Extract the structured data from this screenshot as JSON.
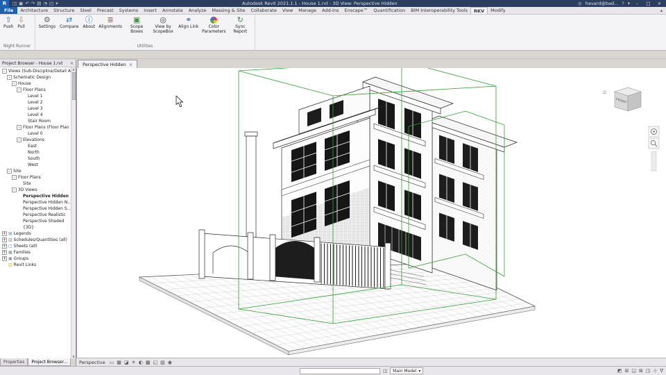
{
  "title_bar": {
    "app_button": "R",
    "title": "Autodesk Revit 2021.1.1 - House 1.rvt - 3D View: Perspective Hidden",
    "qat": [
      {
        "name": "open-icon",
        "glyph": "◫"
      },
      {
        "name": "save-icon",
        "glyph": "▣"
      },
      {
        "name": "undo-icon",
        "glyph": "↶"
      },
      {
        "name": "redo-icon",
        "glyph": "↷"
      },
      {
        "name": "print-icon",
        "glyph": "▤"
      },
      {
        "name": "measure-icon",
        "glyph": "◔"
      },
      {
        "name": "default-3d-view-icon",
        "glyph": "◰"
      },
      {
        "name": "qat-customize-icon",
        "glyph": "▾"
      }
    ],
    "right": {
      "search_glyph": "◎",
      "user": "havard@bad...",
      "help": "?",
      "dropdown": "▾",
      "minimize": "–",
      "maximize": "□",
      "close": "×"
    }
  },
  "ribbon": {
    "tabs": [
      {
        "label": "File",
        "style": "file"
      },
      {
        "label": "Architecture"
      },
      {
        "label": "Structure"
      },
      {
        "label": "Steel"
      },
      {
        "label": "Precast"
      },
      {
        "label": "Systems"
      },
      {
        "label": "Insert"
      },
      {
        "label": "Annotate"
      },
      {
        "label": "Analyze"
      },
      {
        "label": "Massing & Site"
      },
      {
        "label": "Collaborate"
      },
      {
        "label": "View"
      },
      {
        "label": "Manage"
      },
      {
        "label": "Add-Ins"
      },
      {
        "label": "Enscape™"
      },
      {
        "label": "Quantification"
      },
      {
        "label": "BIM Interoperability Tools"
      },
      {
        "label": "RKV",
        "style": "active"
      },
      {
        "label": "Modify"
      }
    ],
    "collapse_glyph": "▴",
    "groups": [
      {
        "label": "Night Runner",
        "buttons": [
          {
            "label": "Push",
            "glyph": "⇧",
            "color": "#2e7cc4"
          },
          {
            "label": "Pull",
            "glyph": "⇩",
            "color": "#c2862a"
          }
        ]
      },
      {
        "label": "Utilities",
        "buttons": [
          {
            "label": "Settings",
            "glyph": "⚙",
            "color": "#666666"
          },
          {
            "label": "Compare",
            "glyph": "⇄",
            "color": "#2e7cc4"
          },
          {
            "label": "About",
            "glyph": "ⓘ",
            "color": "#2e7cc4"
          },
          {
            "label": "Alignments",
            "glyph": "≣",
            "color": "#7a4fa0"
          },
          {
            "label": "Scope Boxes",
            "glyph": "▣",
            "color": "#3f8f3f"
          },
          {
            "label": "View by ScopeBox",
            "glyph": "◎",
            "color": "#444444"
          },
          {
            "label": "Align Link",
            "glyph": "⚭",
            "color": "#2e7cc4"
          },
          {
            "label": "Color Parameters",
            "glyph": "@colorwheel",
            "color": ""
          },
          {
            "label": "Sync Report",
            "glyph": "↻",
            "color": "#3f8f3f"
          }
        ]
      }
    ]
  },
  "project_browser": {
    "header": "Project Browser - House 1.rvt",
    "close_glyph": "×",
    "items": [
      {
        "label": "Views (Sub-Discipline/Detail Area",
        "level": 0,
        "exp": "-"
      },
      {
        "label": "Schematic Design",
        "level": 1,
        "exp": "-"
      },
      {
        "label": "House",
        "level": 2,
        "exp": "-"
      },
      {
        "label": "Floor Plans",
        "level": 3,
        "exp": "-"
      },
      {
        "label": "Level 1",
        "level": 4
      },
      {
        "label": "Level 2",
        "level": 4
      },
      {
        "label": "Level 3",
        "level": 4
      },
      {
        "label": "Level 4",
        "level": 4
      },
      {
        "label": "Stair Room",
        "level": 4
      },
      {
        "label": "Floor Plans (Floor Plan D",
        "level": 3,
        "exp": "-"
      },
      {
        "label": "Level 0",
        "level": 4
      },
      {
        "label": "Elevations",
        "level": 3,
        "exp": "-"
      },
      {
        "label": "East",
        "level": 4
      },
      {
        "label": "North",
        "level": 4
      },
      {
        "label": "South",
        "level": 4
      },
      {
        "label": "West",
        "level": 4
      },
      {
        "label": "Site",
        "level": 1,
        "exp": "-"
      },
      {
        "label": "Floor Plans",
        "level": 2,
        "exp": "-"
      },
      {
        "label": "Site",
        "level": 3
      },
      {
        "label": "3D Views",
        "level": 2,
        "exp": "-"
      },
      {
        "label": "Perspective Hidden",
        "level": 3,
        "bold": true
      },
      {
        "label": "Perspective Hidden N...",
        "level": 3
      },
      {
        "label": "Perspective Hidden S...",
        "level": 3
      },
      {
        "label": "Perspective Realistic",
        "level": 3
      },
      {
        "label": "Perspective Shaded",
        "level": 3
      },
      {
        "label": "{3D}",
        "level": 3
      },
      {
        "label": "Legends",
        "level": 0,
        "exp": "+",
        "icon": "▤",
        "icon_color": "#6a8caf"
      },
      {
        "label": "Schedules/Quantities (all)",
        "level": 0,
        "exp": "+",
        "icon": "▥",
        "icon_color": "#888888"
      },
      {
        "label": "Sheets (all)",
        "level": 0,
        "exp": "+",
        "icon": "▢",
        "icon_color": "#5577aa"
      },
      {
        "label": "Families",
        "level": 0,
        "exp": "+",
        "icon": "▦",
        "icon_color": "#888888"
      },
      {
        "label": "Groups",
        "level": 0,
        "exp": "+",
        "icon": "▣",
        "icon_color": "#888888"
      },
      {
        "label": "Revit Links",
        "level": 0,
        "icon": "◫",
        "icon_color": "#dd8800"
      }
    ],
    "tabs": [
      {
        "label": "Properties",
        "active": false
      },
      {
        "label": "Project Browser...",
        "active": true
      }
    ]
  },
  "viewport": {
    "tab_label": "Perspective Hidden",
    "tab_close": "×",
    "viewcube_label": "FRONT",
    "viewcube_home_glyph": "⌂"
  },
  "view_control_bar": {
    "scale_label": "Perspective",
    "icons": [
      {
        "name": "view-size-icon",
        "glyph": "▭"
      },
      {
        "name": "detail-level-icon",
        "glyph": "▦"
      },
      {
        "name": "visual-style-icon",
        "glyph": "◪"
      },
      {
        "name": "sun-path-icon",
        "glyph": "☀"
      },
      {
        "name": "shadows-icon",
        "glyph": "◐"
      },
      {
        "name": "crop-view-icon",
        "glyph": "▩"
      },
      {
        "name": "show-crop-region-icon",
        "glyph": "◱"
      },
      {
        "name": "temporary-hide-isolate-icon",
        "glyph": "▨"
      },
      {
        "name": "reveal-hidden-elements-icon",
        "glyph": "◉"
      }
    ]
  },
  "status_bar": {
    "design_option_icon": "◫",
    "main_model": "Main Model",
    "dropdown_glyph": "▾",
    "right_icons": [
      {
        "name": "worksharing-display-icon",
        "glyph": "◩"
      },
      {
        "name": "select-links-icon",
        "glyph": "⊞"
      },
      {
        "name": "select-underlay-icon",
        "glyph": "◲"
      },
      {
        "name": "select-pinned-icon",
        "glyph": "⊠"
      },
      {
        "name": "select-by-face-icon",
        "glyph": "◳"
      },
      {
        "name": "drag-on-selection-icon",
        "glyph": "⊹"
      },
      {
        "name": "filter-icon",
        "glyph": "∇"
      }
    ]
  }
}
